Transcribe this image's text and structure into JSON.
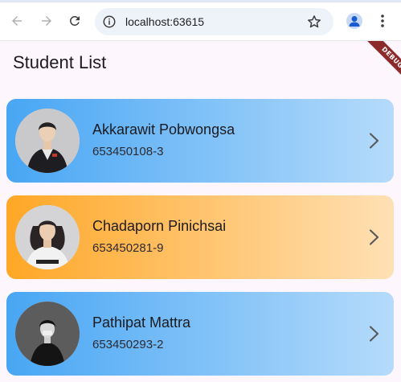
{
  "browser": {
    "url": "localhost:63615",
    "icons": {
      "back": "arrow-back-icon",
      "forward": "arrow-forward-icon",
      "reload": "reload-icon",
      "site_info": "info-icon",
      "bookmark": "star-icon",
      "profile": "profile-icon",
      "menu": "more-vert-icon"
    }
  },
  "app": {
    "title": "Student List",
    "debug_banner": "DEBUG",
    "students": [
      {
        "name": "Akkarawit Pobwongsa",
        "id": "653450108-3",
        "theme": "blue"
      },
      {
        "name": "Chadaporn Pinichsai",
        "id": "653450281-9",
        "theme": "orange"
      },
      {
        "name": "Pathipat Mattra",
        "id": "653450293-2",
        "theme": "blue"
      }
    ]
  },
  "colors": {
    "blue_start": "#48a6f4",
    "blue_end": "#b5dbfb",
    "orange_start": "#ffa726",
    "orange_end": "#ffe0b5",
    "page_background": "#fdf6fd",
    "debug_banner": "#8c2b2b"
  }
}
